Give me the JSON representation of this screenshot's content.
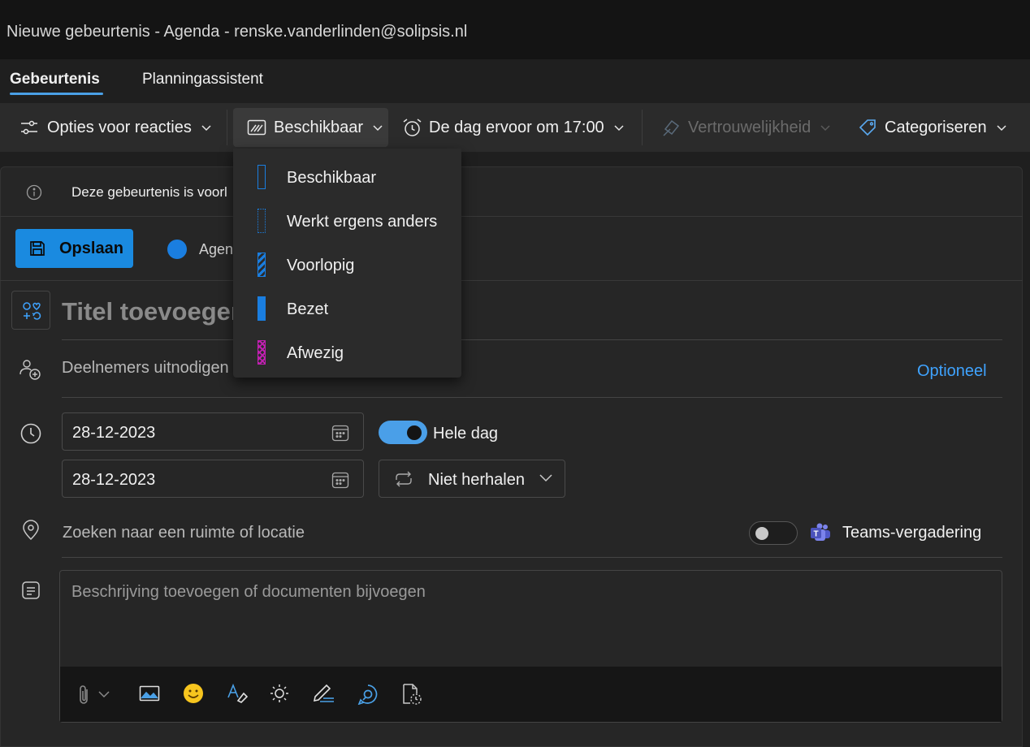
{
  "window": {
    "title": "Nieuwe gebeurtenis - Agenda - renske.vanderlinden@solipsis.nl"
  },
  "tabs": [
    {
      "label": "Gebeurtenis",
      "active": true
    },
    {
      "label": "Planningassistent",
      "active": false
    }
  ],
  "toolbar": {
    "response_options": "Opties voor reacties",
    "show_as": "Beschikbaar",
    "reminder": "De dag ervoor om 17:00",
    "privacy": "Vertrouwelijkheid",
    "categorize": "Categoriseren"
  },
  "show_as_menu": {
    "items": [
      {
        "label": "Beschikbaar",
        "color": "#1a7ee0",
        "pattern": "outline"
      },
      {
        "label": "Werkt ergens anders",
        "color": "#1a7ee0",
        "pattern": "dotted"
      },
      {
        "label": "Voorlopig",
        "color": "#1a7ee0",
        "pattern": "striped"
      },
      {
        "label": "Bezet",
        "color": "#1a7ee0",
        "pattern": "solid"
      },
      {
        "label": "Afwezig",
        "color": "#c020b0",
        "pattern": "crosshatch"
      }
    ]
  },
  "info_bar": {
    "text": "Deze gebeurtenis is voorl"
  },
  "save": {
    "label": "Opslaan"
  },
  "calendar": {
    "label": "Agen",
    "color": "#1a7ee0"
  },
  "form": {
    "title_placeholder": "Titel toevoegen",
    "attendees_placeholder": "Deelnemers uitnodigen",
    "optional_link": "Optioneel",
    "start_date": "28-12-2023",
    "end_date": "28-12-2023",
    "all_day_label": "Hele dag",
    "all_day": true,
    "repeat": "Niet herhalen",
    "location_placeholder": "Zoeken naar een ruimte of locatie",
    "teams_label": "Teams-vergadering",
    "teams_enabled": false,
    "description_placeholder": "Beschrijving toevoegen of documenten bijvoegen"
  },
  "colors": {
    "accent": "#1a8ae0",
    "link": "#3fa3ff",
    "away": "#c020b0"
  }
}
